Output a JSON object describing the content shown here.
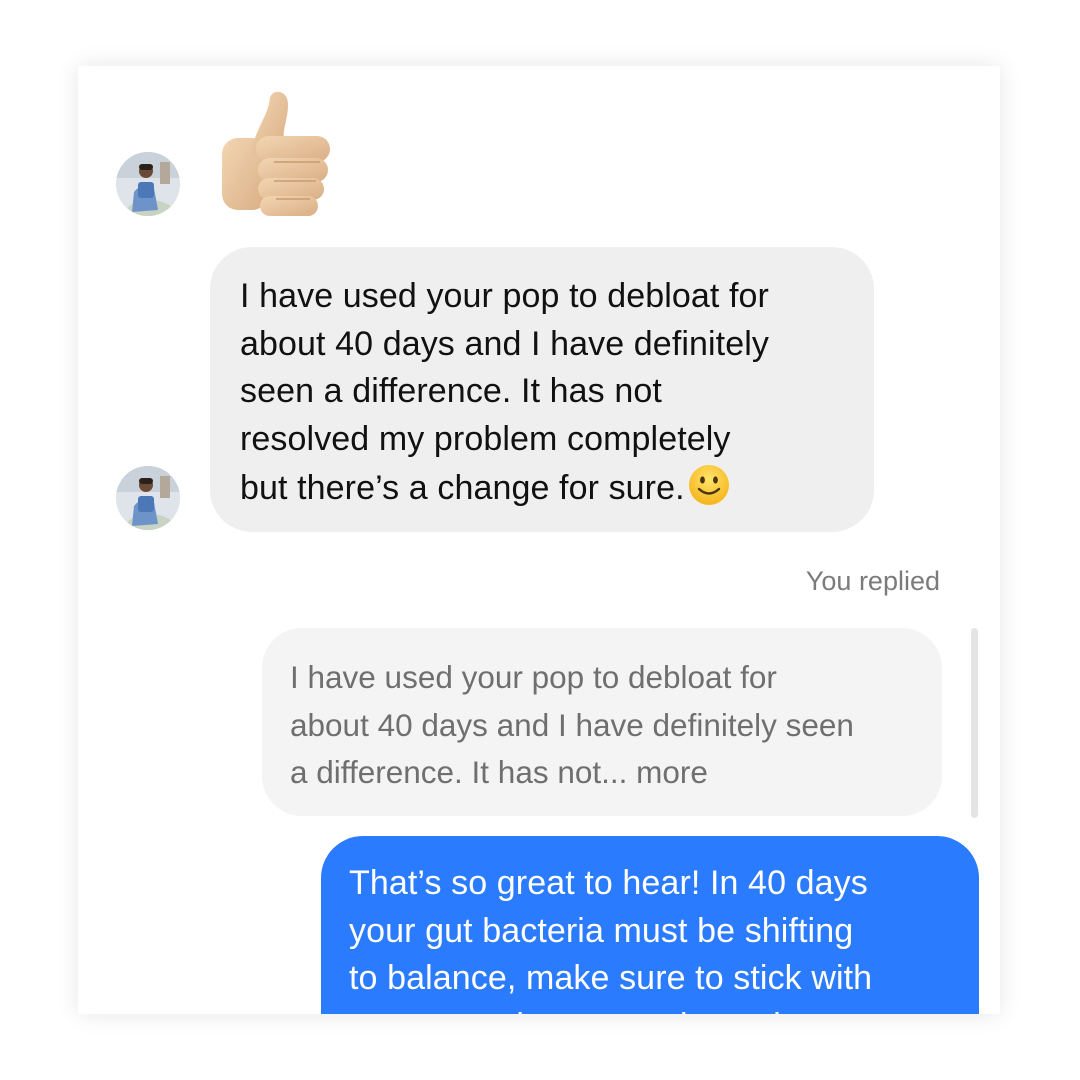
{
  "conversation": {
    "incoming_sticker": "thumbs-up-emoji",
    "incoming_message": {
      "lines": [
        "I have used your pop to debloat for",
        "about 40 days and I have definitely",
        "seen a difference. It has not",
        "resolved my problem completely",
        "but there’s a change for sure."
      ],
      "trailing_emoji": "slightly-smiling-face-emoji"
    },
    "reply_label": "You replied",
    "quoted_message": {
      "lines": [
        "I have used your pop to debloat for",
        "about 40 days and I have definitely seen",
        "a difference. It has not... more"
      ]
    },
    "outgoing_message": {
      "lines": [
        "That’s so great to hear! In 40 days",
        "your gut bacteria must be shifting",
        "to balance, make sure to stick with",
        "you to see better results and"
      ]
    }
  },
  "colors": {
    "incoming_bubble": "#efefef",
    "quoted_bubble": "#f4f4f4",
    "outgoing_bubble": "#2b7bff",
    "outgoing_text": "#ffffff",
    "meta_text": "#7b7b7b"
  },
  "icons": {
    "avatar": "contact-avatar",
    "sticker": "thumbs-up-icon",
    "emoji": "smiley-icon"
  }
}
